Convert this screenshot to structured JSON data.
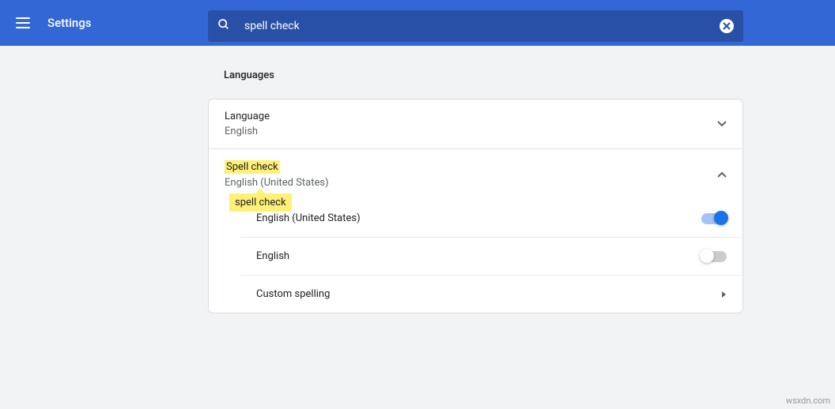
{
  "header": {
    "title": "Settings"
  },
  "search": {
    "value": "spell check"
  },
  "section": {
    "title": "Languages"
  },
  "language_row": {
    "label": "Language",
    "value": "English"
  },
  "spellcheck_row": {
    "label": "Spell check",
    "value": "English (United States)",
    "tooltip": "spell check"
  },
  "items": {
    "en_us": {
      "label": "English (United States)",
      "on": true
    },
    "en": {
      "label": "English",
      "on": false
    },
    "custom": {
      "label": "Custom spelling"
    }
  },
  "watermark": "wsxdn.com"
}
